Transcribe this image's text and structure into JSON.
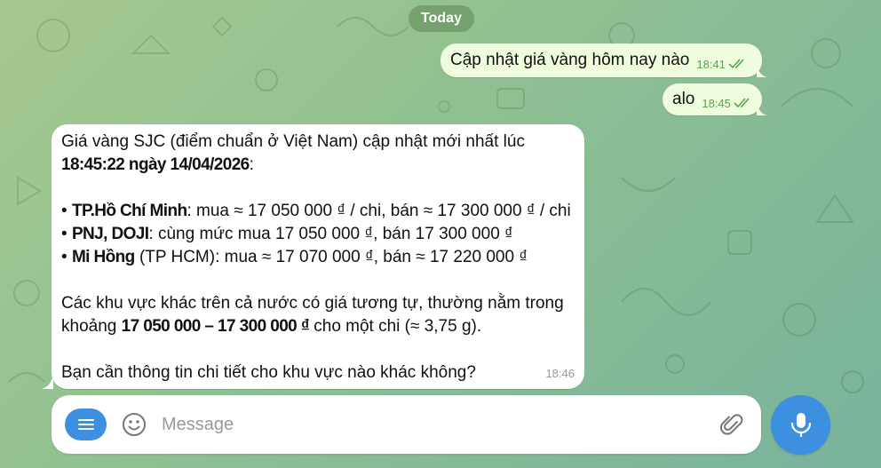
{
  "chat": {
    "date_label": "Today",
    "outgoing": [
      {
        "text": "Cập nhật giá vàng hôm nay nào",
        "time": "18:41"
      },
      {
        "text": "alo",
        "time": "18:45"
      }
    ],
    "incoming": {
      "line1": "Giá vàng SJC (điểm chuẩn ở Việt Nam) cập nhật mới nhất lúc",
      "line2_bold": "18:45:22 ngày 14/04/2026",
      "line2_rest": ":",
      "b1_bold": "TP.Hồ Chí Minh",
      "b1_rest": ": mua ≈ 17 050 000 ₫ / chi, bán ≈ 17 300 000 ₫ / chi",
      "b2_bold": "PNJ, DOJI",
      "b2_rest": ": cùng mức mua 17 050 000 ₫, bán 17 300 000 ₫",
      "b3_bold": "Mi Hồng",
      "b3_rest": " (TP HCM): mua ≈ 17 070 000 ₫, bán ≈ 17 220 000 ₫",
      "para2_line1": "Các khu vực khác trên cả nước có giá tương tự, thường nằm trong",
      "para2_pre": "khoảng ",
      "para2_bold": "17 050 000 – 17 300 000 ₫",
      "para2_post": " cho một chi (≈ 3,75 g).",
      "para3": "Bạn cần thông tin chi tiết cho khu vực nào khác không?",
      "time": "18:46"
    }
  },
  "composer": {
    "placeholder": "Message",
    "menu_icon": "menu-icon",
    "emoji_icon": "emoji-icon",
    "attach_icon": "paperclip-icon",
    "send_icon": "microphone-icon"
  },
  "colors": {
    "accent": "#3d8fe0",
    "outgoing_bubble": "#effdde",
    "incoming_bubble": "#ffffff",
    "check_color": "#58a34f"
  }
}
